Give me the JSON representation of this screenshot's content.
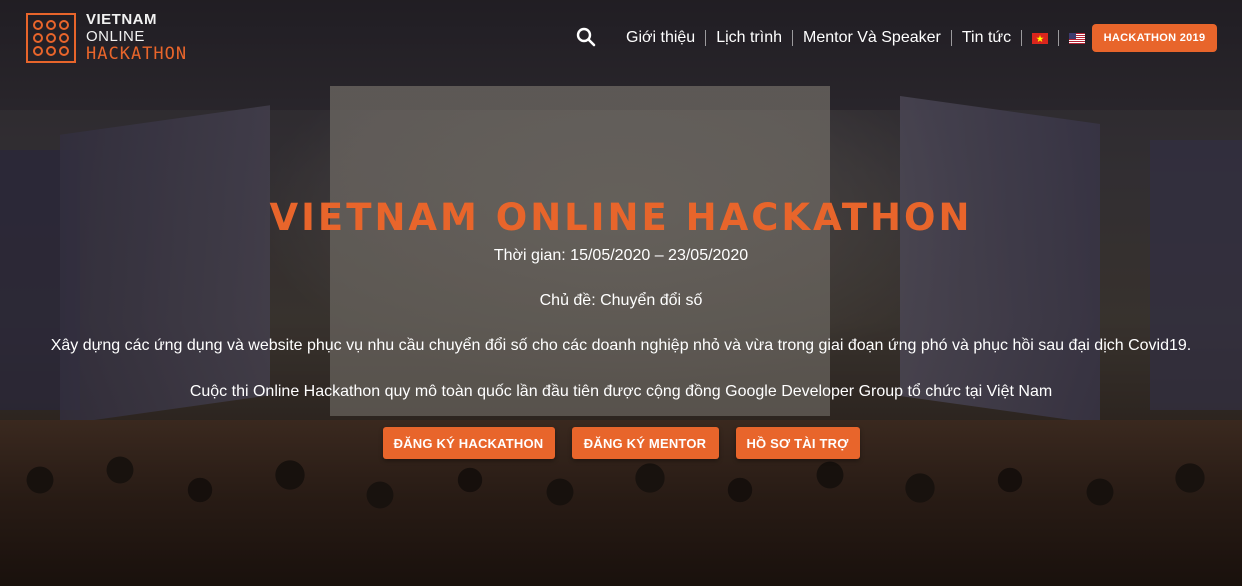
{
  "logo": {
    "line1": "VIETNAM",
    "line2": "ONLINE",
    "line3": "HACKATHON"
  },
  "nav": {
    "search_icon": "search-icon",
    "items": [
      {
        "label": "Giới thiệu"
      },
      {
        "label": "Lịch trình"
      },
      {
        "label": "Mentor Và Speaker"
      },
      {
        "label": "Tin tức"
      }
    ],
    "flags": [
      "flag-vietnam-icon",
      "flag-usa-icon"
    ],
    "cta_label": "HACKATHON 2019"
  },
  "hero": {
    "title": "VIETNAM ONLINE HACKATHON",
    "time": "Thời gian: 15/05/2020 – 23/05/2020",
    "topic": "Chủ đề: Chuyển đổi số",
    "description": "Xây dựng các ứng dụng và website phục vụ nhu cầu chuyển đổi số cho các doanh nghiệp nhỏ và vừa trong giai đoạn ứng phó và phục hồi sau đại dịch Covid19.",
    "description2": "Cuộc thi Online Hackathon quy mô toàn quốc lần đầu tiên được cộng đồng Google Developer Group tổ chức tại Việt Nam",
    "buttons": {
      "register_hackathon": "ĐĂNG KÝ HACKATHON",
      "register_mentor": "ĐĂNG KÝ MENTOR",
      "sponsor_profile": "HỒ SƠ TÀI TRỢ"
    }
  },
  "colors": {
    "accent": "#e8652b",
    "text": "#ffffff"
  }
}
